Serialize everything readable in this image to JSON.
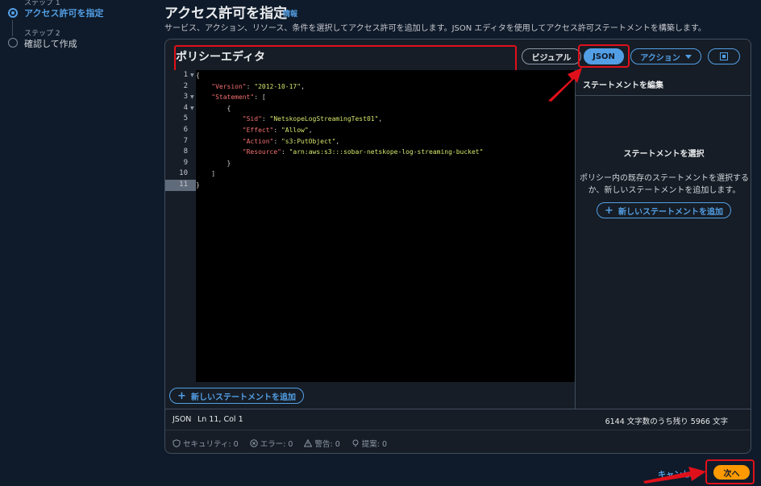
{
  "steps": {
    "step1_caption": "ステップ 1",
    "step1_title": "アクセス許可を指定",
    "step2_caption": "ステップ 2",
    "step2_title": "確認して作成"
  },
  "header": {
    "title": "アクセス許可を指定",
    "info": "情報",
    "description": "サービス、アクション、リソース、条件を選択してアクセス許可を追加します。JSON エディタを使用してアクセス許可ステートメントを構築します。"
  },
  "editor": {
    "title": "ポリシーエディタ",
    "tabs": {
      "visual": "ビジュアル",
      "json": "JSON",
      "action": "アクション"
    },
    "line_numbers": [
      "1",
      "2",
      "3",
      "4",
      "5",
      "6",
      "7",
      "8",
      "9",
      "10",
      "11"
    ],
    "code": {
      "version_key": "\"Version\"",
      "version_val": "\"2012-10-17\"",
      "statement_key": "\"Statement\"",
      "sid_key": "\"Sid\"",
      "sid_val": "\"NetskopeLogStreamingTest01\"",
      "effect_key": "\"Effect\"",
      "effect_val": "\"Allow\"",
      "action_key": "\"Action\"",
      "action_val": "\"s3:PutObject\"",
      "resource_key": "\"Resource\"",
      "resource_val": "\"arn:aws:s3:::sobar-netskope-log-streaming-bucket\""
    },
    "add_statement": "新しいステートメントを追加",
    "status": {
      "mode": "JSON",
      "position": "Ln 11, Col 1",
      "char_count": "6144 文字数のうち残り 5966 文字"
    },
    "checks": {
      "security": "セキュリティ: 0",
      "errors": "エラー: 0",
      "warnings": "警告: 0",
      "suggestions": "提案: 0"
    }
  },
  "statement_panel": {
    "header": "ステートメントを編集",
    "title": "ステートメントを選択",
    "text": "ポリシー内の既存のステートメントを選択するか、新しいステートメントを追加します。",
    "add_statement": "新しいステートメントを追加"
  },
  "footer": {
    "cancel": "キャンセル",
    "next": "次へ"
  },
  "colors": {
    "accent": "#539fe5",
    "primary_button": "#ff9900",
    "annotation": "#e0101b"
  }
}
